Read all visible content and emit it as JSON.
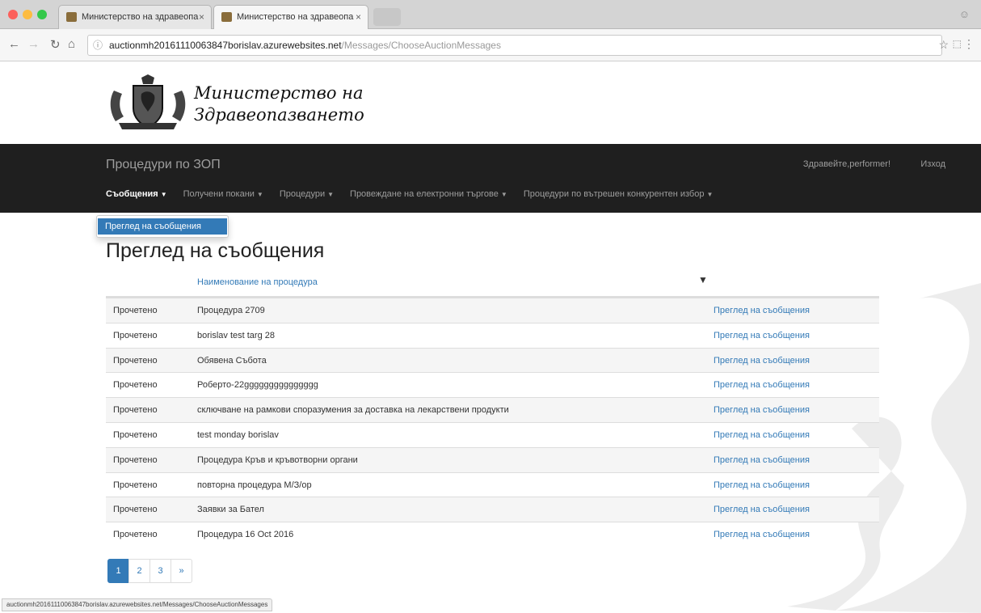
{
  "browser": {
    "tabs": [
      {
        "title": "Министерство на здравеопа"
      },
      {
        "title": "Министерство на здравеопа"
      }
    ],
    "url_host": "auctionmh20161110063847borislav.azurewebsites.net",
    "url_path": "/Messages/ChooseAuctionMessages",
    "status_url": "auctionmh20161110063847borislav.azurewebsites.net/Messages/ChooseAuctionMessages"
  },
  "logo": {
    "line1": "Министерство на",
    "line2": "Здравеопазването"
  },
  "navbar": {
    "brand": "Процедури по ЗОП",
    "greeting": "Здравейте,performer!",
    "logout": "Изход",
    "menu": [
      {
        "label": "Съобщения"
      },
      {
        "label": "Получени покани"
      },
      {
        "label": "Процедури"
      },
      {
        "label": "Провеждане на електронни търгове"
      },
      {
        "label": "Процедури по вътрешен конкурентен избор"
      }
    ]
  },
  "dropdown": {
    "item": "Преглед на съобщения"
  },
  "page": {
    "title": "Преглед на съобщения"
  },
  "table": {
    "column_name": "Наименование на процедура",
    "rows": [
      {
        "status": "Прочетено",
        "name": "Процедура 2709",
        "link": "Преглед на съобщения"
      },
      {
        "status": "Прочетено",
        "name": "borislav test targ 28",
        "link": "Преглед на съобщения"
      },
      {
        "status": "Прочетено",
        "name": "Обявена Събота",
        "link": "Преглед на съобщения"
      },
      {
        "status": "Прочетено",
        "name": "Роберто-22ggggggggggggggg",
        "link": "Преглед на съобщения"
      },
      {
        "status": "Прочетено",
        "name": "сключване на рамкови споразумения за доставка на лекарствени продукти",
        "link": "Преглед на съобщения"
      },
      {
        "status": "Прочетено",
        "name": "test monday borislav",
        "link": "Преглед на съобщения"
      },
      {
        "status": "Прочетено",
        "name": "Процедура Кръв и кръвотворни органи",
        "link": "Преглед на съобщения"
      },
      {
        "status": "Прочетено",
        "name": "повторна процедура М/З/ор",
        "link": "Преглед на съобщения"
      },
      {
        "status": "Прочетено",
        "name": "Заявки за Бател",
        "link": "Преглед на съобщения"
      },
      {
        "status": "Прочетено",
        "name": "Процедура 16 Oct 2016",
        "link": "Преглед на съобщения"
      }
    ]
  },
  "pagination": {
    "pages": [
      "1",
      "2",
      "3",
      "»"
    ]
  }
}
